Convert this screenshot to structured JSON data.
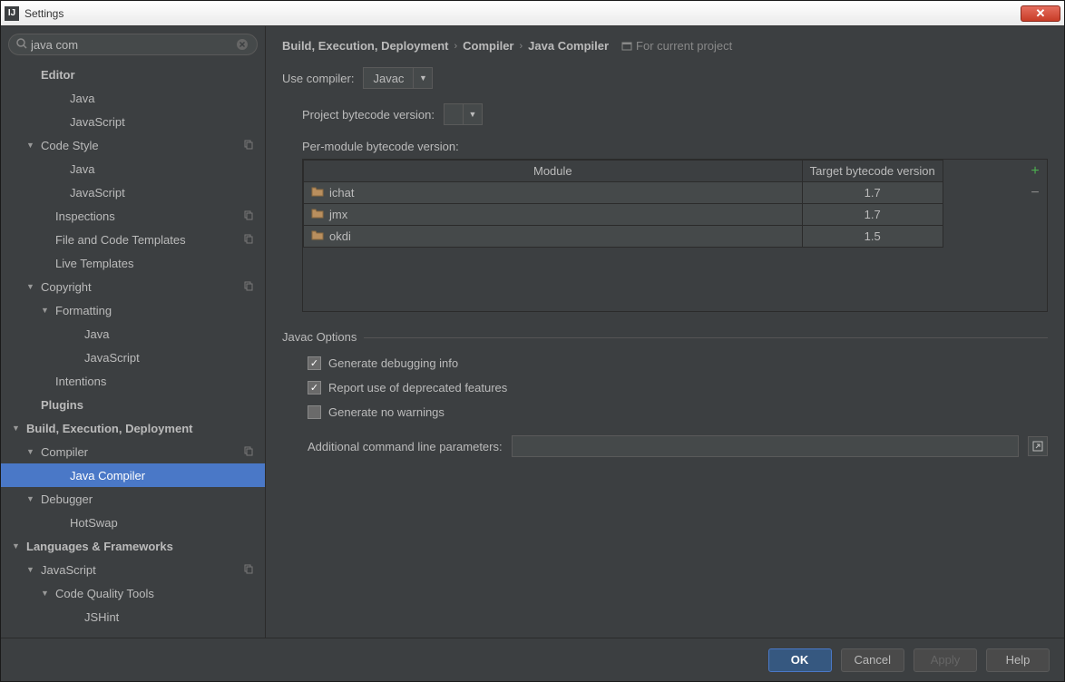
{
  "titlebar": {
    "title": "Settings",
    "icon_text": "IJ"
  },
  "search": {
    "value": "java com"
  },
  "tree": {
    "items": [
      {
        "label": "Editor",
        "level": 1,
        "arrow": "",
        "bold": true
      },
      {
        "label": "Java",
        "level": 3,
        "arrow": ""
      },
      {
        "label": "JavaScript",
        "level": 3,
        "arrow": ""
      },
      {
        "label": "Code Style",
        "level": 1,
        "arrow": "▼",
        "copy": true
      },
      {
        "label": "Java",
        "level": 3,
        "arrow": ""
      },
      {
        "label": "JavaScript",
        "level": 3,
        "arrow": ""
      },
      {
        "label": "Inspections",
        "level": 2,
        "arrow": "",
        "copy": true
      },
      {
        "label": "File and Code Templates",
        "level": 2,
        "arrow": "",
        "copy": true
      },
      {
        "label": "Live Templates",
        "level": 2,
        "arrow": ""
      },
      {
        "label": "Copyright",
        "level": 1,
        "arrow": "▼",
        "copy": true
      },
      {
        "label": "Formatting",
        "level": 2,
        "arrow": "▼"
      },
      {
        "label": "Java",
        "level": 4,
        "arrow": ""
      },
      {
        "label": "JavaScript",
        "level": 4,
        "arrow": ""
      },
      {
        "label": "Intentions",
        "level": 2,
        "arrow": ""
      },
      {
        "label": "Plugins",
        "level": 1,
        "arrow": "",
        "bold": true
      },
      {
        "label": "Build, Execution, Deployment",
        "level": 0,
        "arrow": "▼",
        "bold": true
      },
      {
        "label": "Compiler",
        "level": 1,
        "arrow": "▼",
        "copy": true
      },
      {
        "label": "Java Compiler",
        "level": 3,
        "arrow": "",
        "selected": true
      },
      {
        "label": "Debugger",
        "level": 1,
        "arrow": "▼"
      },
      {
        "label": "HotSwap",
        "level": 3,
        "arrow": ""
      },
      {
        "label": "Languages & Frameworks",
        "level": 0,
        "arrow": "▼",
        "bold": true
      },
      {
        "label": "JavaScript",
        "level": 1,
        "arrow": "▼",
        "copy": true
      },
      {
        "label": "Code Quality Tools",
        "level": 2,
        "arrow": "▼"
      },
      {
        "label": "JSHint",
        "level": 4,
        "arrow": ""
      }
    ]
  },
  "breadcrumb": {
    "parts": [
      "Build, Execution, Deployment",
      "Compiler",
      "Java Compiler"
    ],
    "note": "For current project"
  },
  "compiler": {
    "use_compiler_label": "Use compiler:",
    "use_compiler_value": "Javac",
    "bytecode_label": "Project bytecode version:",
    "bytecode_value": "",
    "per_module_label": "Per-module bytecode version:",
    "table": {
      "headers": [
        "Module",
        "Target bytecode version"
      ],
      "rows": [
        {
          "module": "ichat",
          "version": "1.7"
        },
        {
          "module": "jmx",
          "version": "1.7"
        },
        {
          "module": "okdi",
          "version": "1.5"
        }
      ]
    },
    "options_label": "Javac Options",
    "opt_debug": "Generate debugging info",
    "opt_debug_checked": true,
    "opt_deprecated": "Report use of deprecated features",
    "opt_deprecated_checked": true,
    "opt_nowarn": "Generate no warnings",
    "opt_nowarn_checked": false,
    "params_label": "Additional command line parameters:",
    "params_value": ""
  },
  "footer": {
    "ok": "OK",
    "cancel": "Cancel",
    "apply": "Apply",
    "help": "Help"
  }
}
